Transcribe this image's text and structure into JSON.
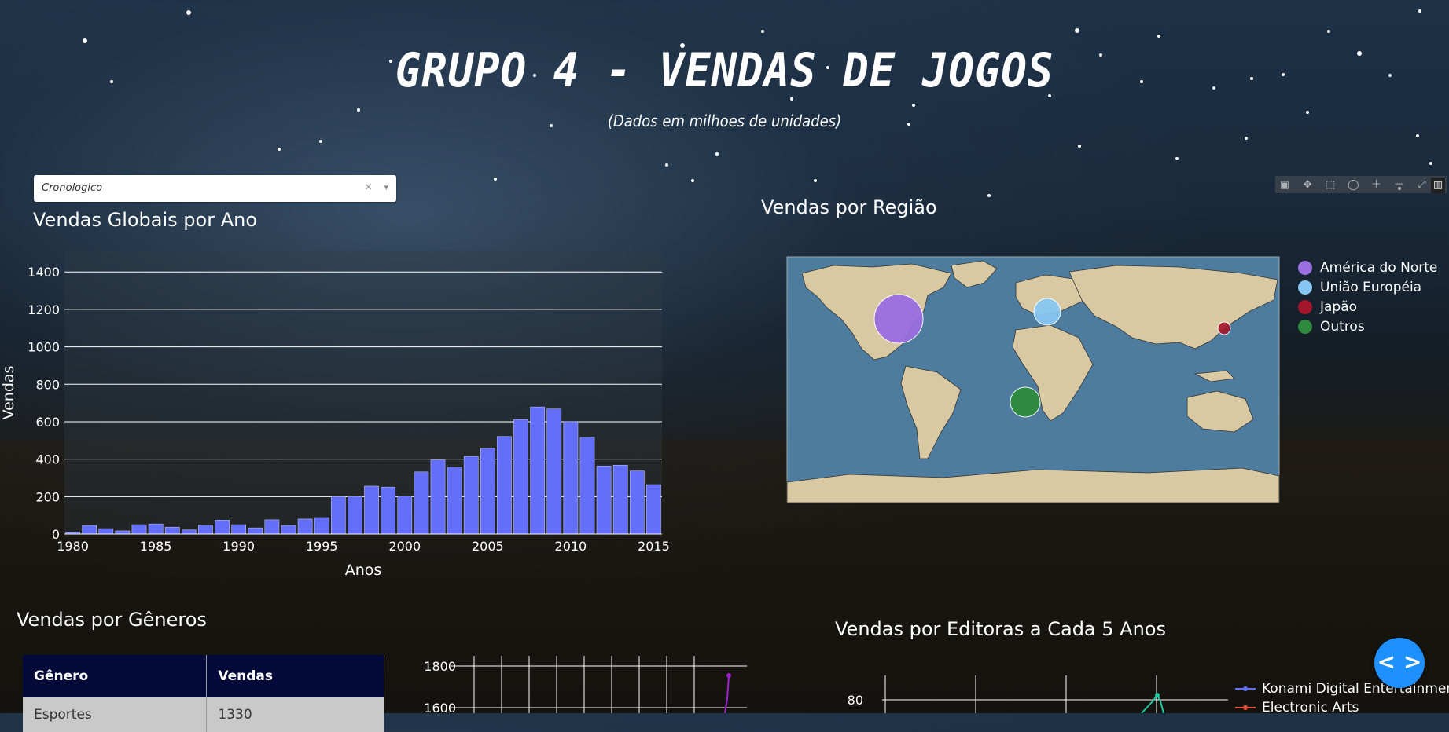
{
  "header": {
    "title": "GRUPO 4 - VENDAS DE JOGOS",
    "subtitle": "(Dados em milhoes de unidades)"
  },
  "dropdown": {
    "value": "Cronologico",
    "clear": "×",
    "arrow": "▾"
  },
  "sections": {
    "global": "Vendas Globais por Ano",
    "region": "Vendas por Região",
    "genres": "Vendas por Gêneros",
    "publishers": "Vendas por Editoras a Cada 5 Anos"
  },
  "modebar": [
    "camera-icon",
    "pan-icon",
    "box-select-icon",
    "lasso-icon",
    "zoom-in-icon",
    "zoom-out-icon",
    "autoscale-icon",
    "plotly-logo-icon"
  ],
  "colors": {
    "bar": "#636efa",
    "ocean": "#4d7c9e",
    "land": "#d9c9a3",
    "na": "#9b6ee0",
    "eu": "#87c6f2",
    "jp": "#a4162c",
    "others": "#2e8b3d",
    "fab": "#1e90ff"
  },
  "chart_data": [
    {
      "type": "bar",
      "title": "Vendas Globais por Ano",
      "xlabel": "Anos",
      "ylabel": "Vendas",
      "x": [
        1980,
        1981,
        1982,
        1983,
        1984,
        1985,
        1986,
        1987,
        1988,
        1989,
        1990,
        1991,
        1992,
        1993,
        1994,
        1995,
        1996,
        1997,
        1998,
        1999,
        2000,
        2001,
        2002,
        2003,
        2004,
        2005,
        2006,
        2007,
        2008,
        2009,
        2010,
        2011,
        2012,
        2013,
        2014,
        2015
      ],
      "values": [
        11,
        46,
        29,
        17,
        50,
        54,
        37,
        22,
        47,
        74,
        50,
        33,
        76,
        46,
        80,
        88,
        200,
        201,
        256,
        251,
        202,
        332,
        396,
        358,
        415,
        458,
        521,
        612,
        679,
        668,
        600,
        517,
        364,
        368,
        337,
        264
      ],
      "xticks": [
        "1980",
        "1985",
        "1990",
        "1995",
        "2000",
        "2005",
        "2010",
        "2015"
      ],
      "yticks": [
        "0",
        "200",
        "400",
        "600",
        "800",
        "1000",
        "1200",
        "1400"
      ],
      "ylim": [
        0,
        1510
      ]
    },
    {
      "type": "scatter",
      "title": "Vendas por Região",
      "series": [
        {
          "name": "América do Norte"
        },
        {
          "name": "União Européia"
        },
        {
          "name": "Japão"
        },
        {
          "name": "Outros"
        }
      ],
      "legend": "right"
    },
    {
      "type": "line",
      "yticks": [
        "1800",
        "1600"
      ]
    },
    {
      "type": "line",
      "title": "Vendas por Editoras a Cada 5 Anos",
      "yticks": [
        "80"
      ],
      "series": [
        {
          "name": "Konami Digital Entertainment"
        },
        {
          "name": "Electronic Arts"
        }
      ]
    }
  ],
  "genres_table": {
    "headers": [
      "Gênero",
      "Vendas"
    ],
    "rows": [
      [
        "Esportes",
        "1330"
      ]
    ]
  },
  "fab": {
    "label": "< >"
  }
}
